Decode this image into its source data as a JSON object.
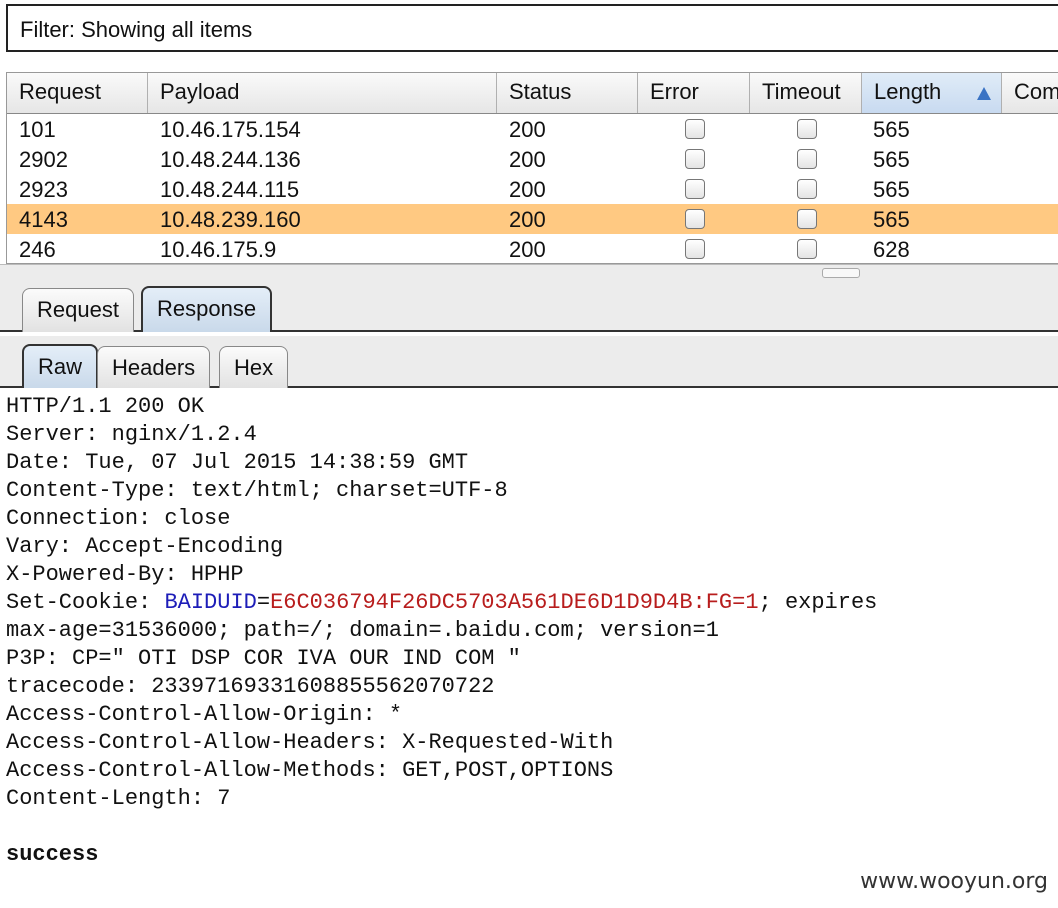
{
  "filter": {
    "text": "Filter: Showing all items"
  },
  "table": {
    "columns": [
      "Request",
      "Payload",
      "Status",
      "Error",
      "Timeout",
      "Length",
      "Com"
    ],
    "rows": [
      {
        "request": "101",
        "payload": "10.46.175.154",
        "status": "200",
        "error": false,
        "timeout": false,
        "length": "565"
      },
      {
        "request": "2902",
        "payload": "10.48.244.136",
        "status": "200",
        "error": false,
        "timeout": false,
        "length": "565"
      },
      {
        "request": "2923",
        "payload": "10.48.244.115",
        "status": "200",
        "error": false,
        "timeout": false,
        "length": "565"
      },
      {
        "request": "4143",
        "payload": "10.48.239.160",
        "status": "200",
        "error": false,
        "timeout": false,
        "length": "565",
        "selected": true
      },
      {
        "request": "246",
        "payload": "10.46.175.9",
        "status": "200",
        "error": false,
        "timeout": false,
        "length": "628"
      }
    ],
    "sort_column": "Length",
    "selected_row_color": "#ffc982"
  },
  "tabs": {
    "main": [
      "Request",
      "Response"
    ],
    "main_active": "Response",
    "view": [
      "Raw",
      "Headers",
      "Hex"
    ],
    "view_active": "Raw"
  },
  "response": {
    "lines": [
      "HTTP/1.1 200 OK",
      "Server: nginx/1.2.4",
      "Date: Tue, 07 Jul 2015 14:38:59 GMT",
      "Content-Type: text/html; charset=UTF-8",
      "Connection: close",
      "Vary: Accept-Encoding",
      "X-Powered-By: HPHP"
    ],
    "cookie_prefix": "Set-Cookie: ",
    "cookie_name": "BAIDUID",
    "cookie_eq": "=",
    "cookie_value": "E6C036794F26DC5703A561DE6D1D9D4B:FG=1",
    "cookie_rest": "; expires",
    "lines_after": [
      "max-age=31536000; path=/; domain=.baidu.com; version=1",
      "P3P: CP=\" OTI DSP COR IVA OUR IND COM \"",
      "tracecode: 23397169331608855562070722",
      "Access-Control-Allow-Origin: *",
      "Access-Control-Allow-Headers: X-Requested-With",
      "Access-Control-Allow-Methods: GET,POST,OPTIONS",
      "Content-Length: 7"
    ],
    "body": "success"
  },
  "watermark": "www.wooyun.org",
  "colors": {
    "cookie_name": "#1d1db8",
    "cookie_value": "#b81d1d",
    "active_tab": "#c9d9ea"
  }
}
